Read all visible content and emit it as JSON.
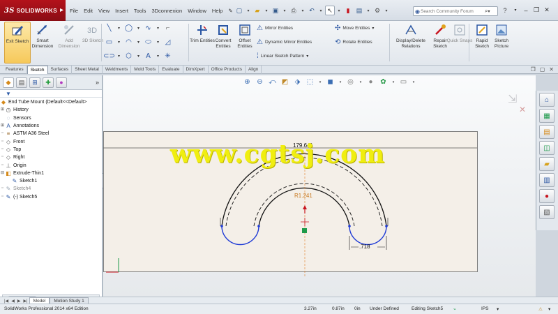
{
  "app": {
    "brand": "SOLIDWORKS",
    "brand_prefix": "3S"
  },
  "menu": [
    {
      "label": "File"
    },
    {
      "label": "Edit"
    },
    {
      "label": "View"
    },
    {
      "label": "Insert"
    },
    {
      "label": "Tools"
    },
    {
      "label": "3Dconnexion"
    },
    {
      "label": "Window"
    },
    {
      "label": "Help"
    }
  ],
  "search": {
    "placeholder": "Search Community Forum"
  },
  "ribbon": {
    "exit_sketch": "Exit Sketch",
    "smart_dimension": "Smart Dimension",
    "add_dimension": "Add Dimension",
    "sketch_3d": "3D Sketch",
    "trim_entities": "Trim Entities",
    "convert_entities": "Convert Entities",
    "offset_entities": "Offset Entities",
    "mirror_entities": "Mirror Entities",
    "dynamic_mirror": "Dynamic Mirror Entities",
    "linear_pattern": "Linear Sketch Pattern",
    "move_entities": "Move Entities",
    "rotate_entities": "Rotate Entities",
    "display_delete": "Display/Delete Relations",
    "repair_sketch": "Repair Sketch",
    "quick_snaps": "Quick Snaps",
    "rapid_sketch": "Rapid Sketch",
    "sketch_picture": "Sketch Picture"
  },
  "tabs": [
    {
      "label": "Features",
      "active": false
    },
    {
      "label": "Sketch",
      "active": true
    },
    {
      "label": "Surfaces",
      "active": false
    },
    {
      "label": "Sheet Metal",
      "active": false
    },
    {
      "label": "Weldments",
      "active": false
    },
    {
      "label": "Mold Tools",
      "active": false
    },
    {
      "label": "Evaluate",
      "active": false
    },
    {
      "label": "DimXpert",
      "active": false
    },
    {
      "label": "Office Products",
      "active": false
    },
    {
      "label": "Align",
      "active": false
    }
  ],
  "tree": {
    "root": "End Tube Mount  (Default<<Default>",
    "items": [
      {
        "label": "History",
        "icon": "history-icon"
      },
      {
        "label": "Sensors",
        "icon": "sensor-icon"
      },
      {
        "label": "Annotations",
        "icon": "annotation-icon"
      },
      {
        "label": "ASTM A36 Steel",
        "icon": "material-icon"
      },
      {
        "label": "Front",
        "icon": "plane-icon"
      },
      {
        "label": "Top",
        "icon": "plane-icon"
      },
      {
        "label": "Right",
        "icon": "plane-icon"
      },
      {
        "label": "Origin",
        "icon": "origin-icon"
      },
      {
        "label": "Extrude-Thin1",
        "icon": "extrude-icon"
      },
      {
        "label": "Sketch1",
        "icon": "sketch-icon"
      },
      {
        "label": "Sketch4",
        "icon": "sketch-icon"
      },
      {
        "label": "(-) Sketch5",
        "icon": "sketch-icon"
      }
    ]
  },
  "sketch": {
    "dim_angle": "179.64°",
    "dim_radius": "R1.241",
    "dim_width": ".718",
    "watermark": "www.cgtsj.com"
  },
  "bottom_tabs": [
    {
      "label": "Model",
      "active": true
    },
    {
      "label": "Motion Study 1",
      "active": false
    }
  ],
  "status": {
    "product": "SolidWorks Professional 2014 x64 Edition",
    "x": "3.27in",
    "y": "0.87in",
    "z": "0in",
    "definition": "Under Defined",
    "mode": "Editing Sketch5",
    "units": "IPS"
  },
  "colors": {
    "brand_red": "#b3121b",
    "active_tool": "#f6c95b",
    "sketch_blue": "#1f3bd6",
    "sketch_black": "#111111",
    "dimension_orange": "#c8781e",
    "watermark_yellow": "#f0ee10"
  }
}
